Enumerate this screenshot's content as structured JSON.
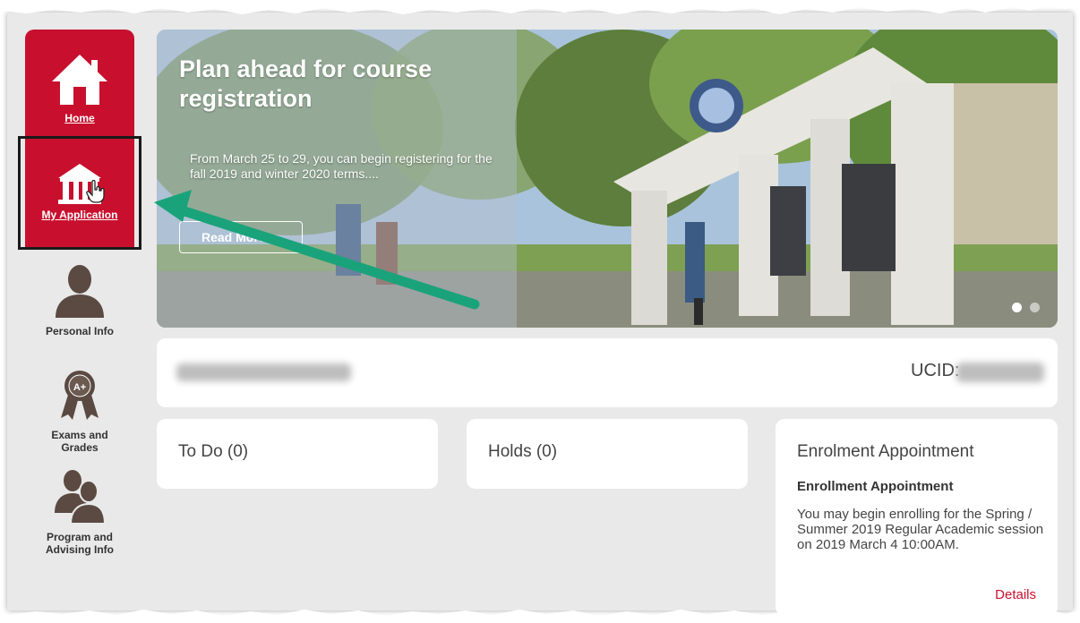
{
  "sidebar": {
    "items": [
      {
        "label": "Home",
        "icon": "house-icon"
      },
      {
        "label": "My Application",
        "icon": "institution-icon"
      },
      {
        "label": "Personal Info",
        "icon": "person-icon"
      },
      {
        "label": "Exams and Grades",
        "icon": "award-ribbon-icon",
        "badge": "A+"
      },
      {
        "label": "Program and Advising Info",
        "icon": "people-icon"
      }
    ]
  },
  "banner": {
    "title": "Plan ahead for course registration",
    "text": "From March 25 to 29, you can begin registering for the fall 2019 and winter 2020 terms....",
    "button_label": "Read More",
    "slide_count": 2,
    "active_slide": 1
  },
  "student": {
    "ucid_label": "UCID:"
  },
  "cards": {
    "todo": "To Do (0)",
    "holds": "Holds (0)",
    "enrolment": {
      "title": "Enrolment Appointment",
      "subtitle": "Enrollment Appointment",
      "text": "You may begin enrolling for the Spring / Summer 2019 Regular Academic session on 2019 March 4 10:00AM.",
      "link": "Details"
    }
  },
  "colors": {
    "accent": "#c8102e",
    "background": "#e9e9e9",
    "annotation_arrow": "#1aa37a"
  }
}
